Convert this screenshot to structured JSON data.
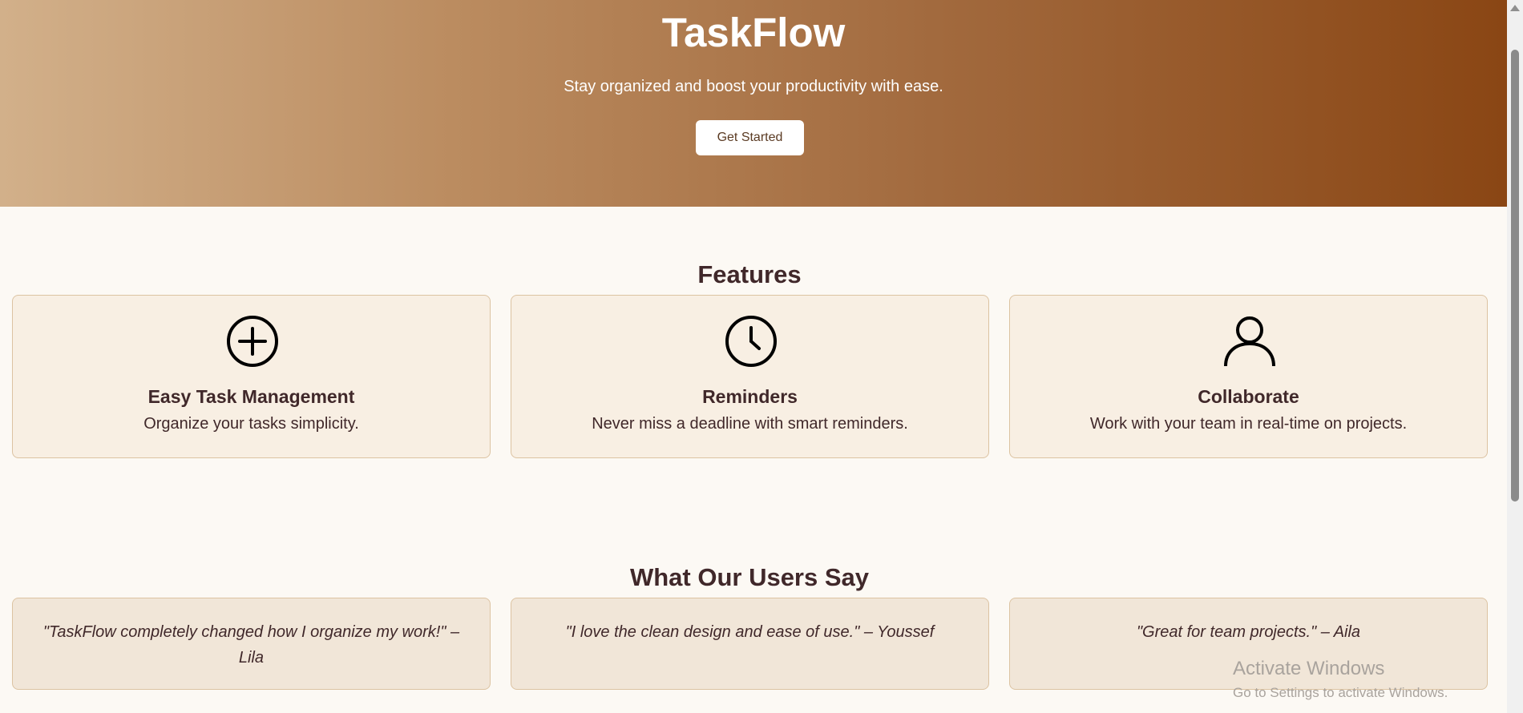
{
  "hero": {
    "title": "TaskFlow",
    "subtitle": "Stay organized and boost your productivity with ease.",
    "cta_label": "Get Started"
  },
  "features": {
    "heading": "Features",
    "items": [
      {
        "icon": "plus-circle-icon",
        "title": "Easy Task Management",
        "description": "Organize your tasks simplicity."
      },
      {
        "icon": "clock-icon",
        "title": "Reminders",
        "description": "Never miss a deadline with smart reminders."
      },
      {
        "icon": "user-icon",
        "title": "Collaborate",
        "description": "Work with your team in real-time on projects."
      }
    ]
  },
  "testimonials": {
    "heading": "What Our Users Say",
    "items": [
      {
        "quote": "\"TaskFlow completely changed how I organize my work!\" – Lila"
      },
      {
        "quote": "\"I love the clean design and ease of use.\" – Youssef"
      },
      {
        "quote": "\"Great for team projects.\" – Aila"
      }
    ]
  },
  "watermark": {
    "title": "Activate Windows",
    "subtitle": "Go to Settings to activate Windows."
  },
  "colors": {
    "hero_gradient_start": "#d2b08a",
    "hero_gradient_end": "#8a4614",
    "page_background": "#fcf9f4",
    "feature_card_background": "#f8efe3",
    "testimonial_card_background": "#f1e6d8",
    "card_border": "#dcc3a2",
    "text_dark": "#40282a"
  }
}
